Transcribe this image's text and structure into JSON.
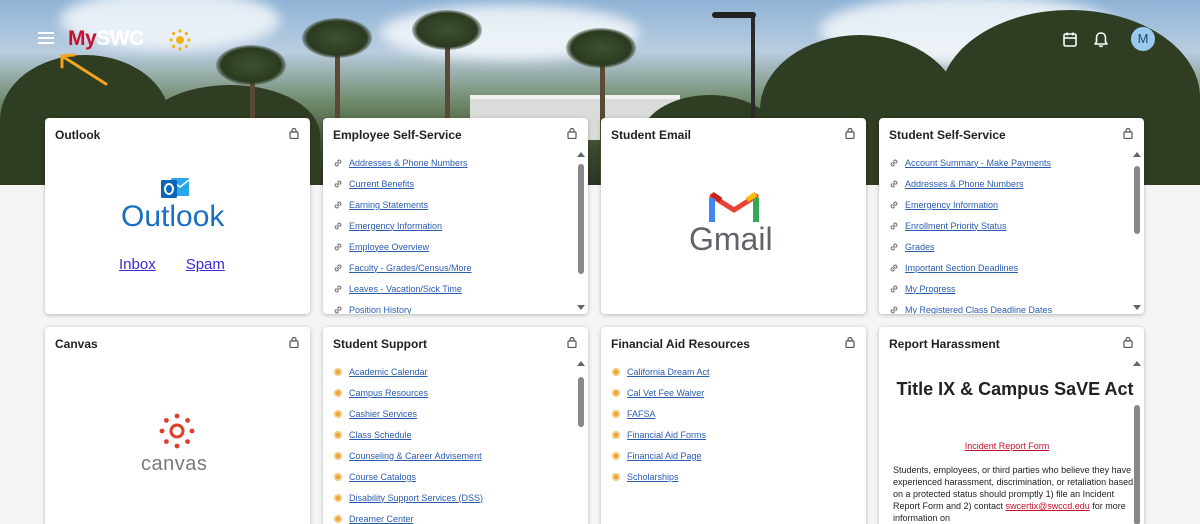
{
  "header": {
    "logo_my": "My",
    "logo_swc": "SWC",
    "avatar_initial": "M"
  },
  "cards": {
    "outlook": {
      "title": "Outlook",
      "logo_text": "Outlook",
      "inbox": "Inbox",
      "spam": "Spam"
    },
    "ess": {
      "title": "Employee Self-Service",
      "items": [
        "Addresses & Phone Numbers",
        "Current Benefits",
        "Earning Statements",
        "Emergency Information",
        "Employee Overview",
        "Faculty - Grades/Census/More",
        "Leaves - Vacation/Sick Time",
        "Position History"
      ]
    },
    "student_email": {
      "title": "Student Email",
      "logo_text": "Gmail"
    },
    "sss": {
      "title": "Student Self-Service",
      "items": [
        "Account Summary - Make Payments",
        "Addresses & Phone Numbers",
        "Emergency Information",
        "Enrollment Priority Status",
        "Grades",
        "Important Section Deadlines",
        "My Progress",
        "My Registered Class Deadline Dates"
      ]
    },
    "canvas": {
      "title": "Canvas",
      "logo_text": "canvas"
    },
    "support": {
      "title": "Student Support",
      "items": [
        "Academic Calendar",
        "Campus Resources",
        "Cashier Services",
        "Class Schedule",
        "Counseling & Career Advisement",
        "Course Catalogs",
        "Disability Support Services (DSS)",
        "Dreamer Center"
      ]
    },
    "finaid": {
      "title": "Financial Aid Resources",
      "items": [
        "California Dream Act",
        "Cal Vet Fee Waiver",
        "FAFSA",
        "Financial Aid Forms",
        "Financial Aid Page",
        "Scholarships"
      ]
    },
    "harassment": {
      "title": "Report Harassment",
      "heading": "Title IX & Campus SaVE Act",
      "link": "Incident Report Form",
      "body_1": "Students, employees, or third parties who believe they have experienced harassment, discrimination, or retaliation based on a protected status should promptly 1) file an Incident Report Form and 2) contact ",
      "email": "swcertix@swccd.edu",
      "body_2": " for more information on"
    }
  }
}
